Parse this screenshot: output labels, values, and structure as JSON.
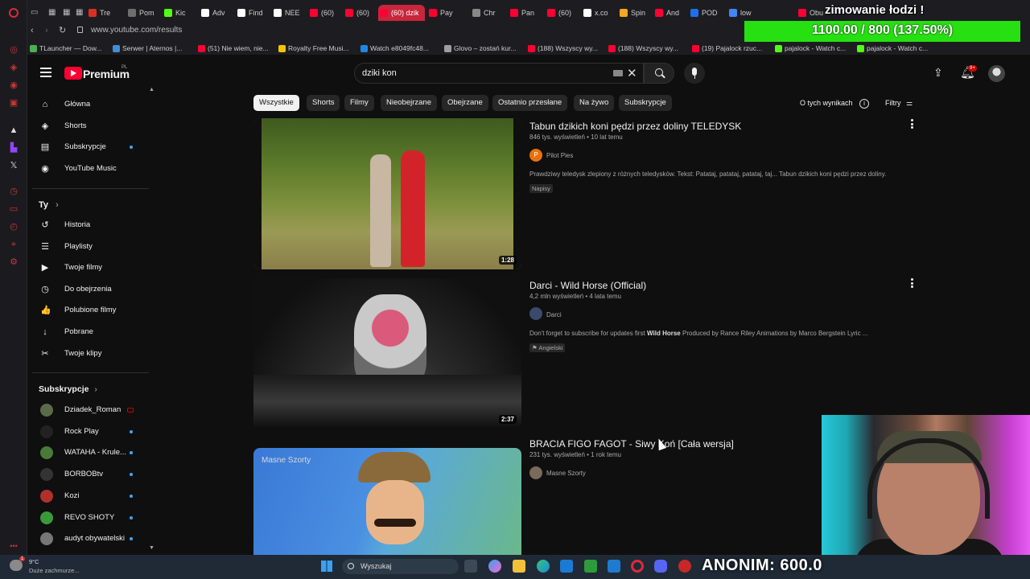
{
  "browser": {
    "url": "www.youtube.com/results",
    "tabs": [
      {
        "label": "Tre",
        "color": "#d93025"
      },
      {
        "label": "Pom",
        "color": "#6e6e6e"
      },
      {
        "label": "Kic",
        "color": "#53fc18"
      },
      {
        "label": "Adv",
        "color": "#ffffff"
      },
      {
        "label": "Find",
        "color": "#ffffff"
      },
      {
        "label": "NEE",
        "color": "#ffffff"
      },
      {
        "label": "(60)",
        "color": "#ff0033"
      },
      {
        "label": "(60)",
        "color": "#ff0033"
      },
      {
        "label": "(60) dzik",
        "color": "#ff0033",
        "active": true
      },
      {
        "label": "Pay",
        "color": "#ff0033"
      },
      {
        "label": "Chr",
        "color": "#888888"
      },
      {
        "label": "Pan",
        "color": "#ff0033"
      },
      {
        "label": "(60)",
        "color": "#ff0033"
      },
      {
        "label": "x.co",
        "color": "#ffffff"
      },
      {
        "label": "Spin",
        "color": "#f5a623"
      },
      {
        "label": "And",
        "color": "#ff0033"
      },
      {
        "label": "POD",
        "color": "#1f6feb"
      },
      {
        "label": "low",
        "color": "#4285f4"
      },
      {
        "label": "Obu",
        "color": "#ff0033"
      }
    ],
    "bookmarks": [
      {
        "label": "TLauncher — Dow...",
        "color": "#4caf50"
      },
      {
        "label": "Serwer | Aternos |...",
        "color": "#3f8fd6"
      },
      {
        "label": "(51) Nie wiem, nie...",
        "color": "#ff0033"
      },
      {
        "label": "Royalty Free Musi...",
        "color": "#f5c400"
      },
      {
        "label": "Watch e8049fc48...",
        "color": "#1e88e5"
      },
      {
        "label": "Glovo – zostań kur...",
        "color": "#9e9e9e"
      },
      {
        "label": "(188) Wszyscy wy...",
        "color": "#ff0033"
      },
      {
        "label": "(188) Wszyscy wy...",
        "color": "#ff0033"
      },
      {
        "label": "(19) Pajalock rzuc...",
        "color": "#ff0033"
      },
      {
        "label": "pajalock - Watch c...",
        "color": "#53fc18"
      },
      {
        "label": "pajalock - Watch c...",
        "color": "#53fc18"
      }
    ]
  },
  "youtube": {
    "brand": "Premium",
    "region": "PL",
    "search_query": "dziki kon",
    "notification_count": "9+",
    "nav_main": [
      {
        "label": "Główna",
        "icon": "home-icon",
        "glyph": "⌂"
      },
      {
        "label": "Shorts",
        "icon": "shorts-icon",
        "glyph": "◈"
      },
      {
        "label": "Subskrypcje",
        "icon": "subscriptions-icon",
        "glyph": "▤"
      },
      {
        "label": "YouTube Music",
        "icon": "music-icon",
        "glyph": "◉"
      }
    ],
    "you_heading": "Ty",
    "nav_you": [
      {
        "label": "Historia",
        "icon": "history-icon",
        "glyph": "↺"
      },
      {
        "label": "Playlisty",
        "icon": "playlist-icon",
        "glyph": "☰"
      },
      {
        "label": "Twoje filmy",
        "icon": "your-videos-icon",
        "glyph": "▶"
      },
      {
        "label": "Do obejrzenia",
        "icon": "watch-later-icon",
        "glyph": "◷"
      },
      {
        "label": "Polubione filmy",
        "icon": "like-icon",
        "glyph": "👍"
      },
      {
        "label": "Pobrane",
        "icon": "download-icon",
        "glyph": "↓"
      },
      {
        "label": "Twoje klipy",
        "icon": "scissors-icon",
        "glyph": "✂"
      }
    ],
    "subs_heading": "Subskrypcje",
    "subscriptions": [
      {
        "label": "Dziadek_Roman",
        "color": "#5a6b4a",
        "live": true
      },
      {
        "label": "Rock Play",
        "color": "#222222",
        "live": false
      },
      {
        "label": "WATAHA - Krule...",
        "color": "#4a7a3a",
        "live": false
      },
      {
        "label": "BORBOBtv",
        "color": "#333333",
        "live": false
      },
      {
        "label": "Kozi",
        "color": "#b0302a",
        "live": false
      },
      {
        "label": "REVO SHOTY",
        "color": "#3a9a3a",
        "live": false
      },
      {
        "label": "audyt obywatelski",
        "color": "#777777",
        "live": false
      }
    ],
    "chips": [
      "Wszystkie",
      "Shorts",
      "Filmy",
      "Nieobejrzane",
      "Obejrzane",
      "Ostatnio przesłane",
      "Na żywo",
      "Subskrypcje"
    ],
    "about_results": "O tych wynikach",
    "filters": "Filtry",
    "results": [
      {
        "title": "Tabun dzikich koni pędzi przez doliny TELEDYSK",
        "meta": "846 tys. wyświetleń • 10 lat temu",
        "channel": "Pilot Pies",
        "channel_initial": "P",
        "channel_color": "#e8710a",
        "description": "Prawdziwy teledysk zlepiony z różnych teledysków. Tekst: Patataj, patataj, patataj, taj... Tabun dzikich koni pędzi przez doliny.",
        "badge": "Napisy",
        "duration": "1:28"
      },
      {
        "title": "Darci - Wild Horse (Official)",
        "meta": "4,2 mln wyświetleń • 4 lata temu",
        "channel": "Darci",
        "channel_initial": "",
        "channel_color": "#3a4a6a",
        "description_pre": "Don't forget to subscribe for updates first ",
        "description_bold": "Wild Horse",
        "description_post": " Produced by Rance Riley Animations by Marco Bergstein Lyric ...",
        "badge": "Angielski",
        "duration": "2:37"
      },
      {
        "title": "BRACIA FIGO FAGOT - Siwy Koń [Cała wersja]",
        "meta": "231 tys. wyświetleń • 1 rok temu",
        "channel": "Masne Szorty",
        "channel_initial": "",
        "channel_color": "#7a6a5a",
        "thumb_watermark": "Masne Szorty"
      }
    ]
  },
  "stream_overlay": {
    "title": "zimowanie łodzi !",
    "goal_text": "1100.00 / 800 (137.50%)",
    "donation_text": "ANONIM: 600.0"
  },
  "taskbar": {
    "search_placeholder": "Wyszukaj",
    "weather_temp": "9°C",
    "weather_desc": "Duże zachmurze...",
    "weather_alert": "1"
  }
}
